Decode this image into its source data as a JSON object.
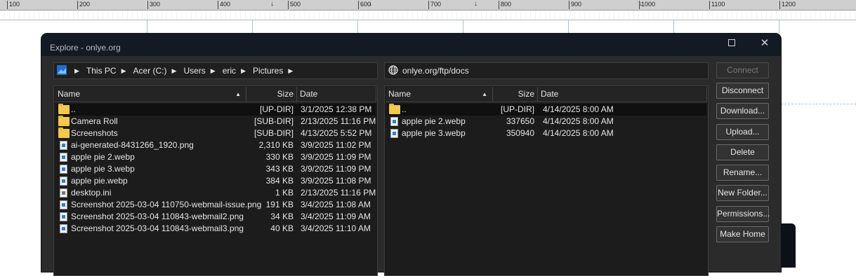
{
  "ruler": {
    "labels": [
      "100",
      "200",
      "300",
      "400",
      "500",
      "600",
      "700",
      "800",
      "900",
      "1000",
      "1100",
      "1200"
    ],
    "tab_stop": "↓"
  },
  "window": {
    "title": "Explore  - onlye.org",
    "maximize_label": "",
    "close_label": "✕"
  },
  "local": {
    "breadcrumbs": [
      "This PC",
      "Acer (C:)",
      "Users",
      "eric",
      "Pictures"
    ],
    "columns": {
      "name": "Name",
      "size": "Size",
      "date": "Date"
    },
    "sort_indicator": "▲",
    "files": [
      {
        "name": "..",
        "size": "[UP-DIR]",
        "date": "3/1/2025 12:38 PM",
        "icon": "folder"
      },
      {
        "name": "Camera Roll",
        "size": "[SUB-DIR]",
        "date": "2/13/2025 11:16 PM",
        "icon": "folder"
      },
      {
        "name": "Screenshots",
        "size": "[SUB-DIR]",
        "date": "4/13/2025 5:52 PM",
        "icon": "folder"
      },
      {
        "name": "ai-generated-8431266_1920.png",
        "size": "2,310 KB",
        "date": "3/9/2025 11:02 PM",
        "icon": "image"
      },
      {
        "name": "apple pie 2.webp",
        "size": "330 KB",
        "date": "3/9/2025 11:09 PM",
        "icon": "image"
      },
      {
        "name": "apple pie 3.webp",
        "size": "343 KB",
        "date": "3/9/2025 11:09 PM",
        "icon": "image"
      },
      {
        "name": "apple pie.webp",
        "size": "384 KB",
        "date": "3/9/2025 11:08 PM",
        "icon": "image"
      },
      {
        "name": "desktop.ini",
        "size": "1 KB",
        "date": "2/13/2025 11:16 PM",
        "icon": "settings-file"
      },
      {
        "name": "Screenshot 2025-03-04 110750-webmail-issue.png",
        "size": "191 KB",
        "date": "3/4/2025 11:08 AM",
        "icon": "image"
      },
      {
        "name": "Screenshot 2025-03-04 110843-webmail2.png",
        "size": "34 KB",
        "date": "3/4/2025 11:09 AM",
        "icon": "image"
      },
      {
        "name": "Screenshot 2025-03-04 110843-webmail3.png",
        "size": "40 KB",
        "date": "3/4/2025 11:10 AM",
        "icon": "image"
      }
    ]
  },
  "remote": {
    "path": "onlye.org/ftp/docs",
    "columns": {
      "name": "Name",
      "size": "Size",
      "date": "Date"
    },
    "sort_indicator": "▲",
    "files": [
      {
        "name": "..",
        "size": "[UP-DIR]",
        "date": "4/14/2025 8:00 AM",
        "icon": "folder"
      },
      {
        "name": "apple pie 2.webp",
        "size": "337650",
        "date": "4/14/2025 8:00 AM",
        "icon": "image"
      },
      {
        "name": "apple pie 3.webp",
        "size": "350940",
        "date": "4/14/2025 8:00 AM",
        "icon": "image"
      }
    ]
  },
  "buttons": {
    "connect": "Connect",
    "disconnect": "Disconnect",
    "download": "Download...",
    "upload": "Upload...",
    "delete": "Delete",
    "rename": "Rename...",
    "new_folder": "New Folder...",
    "permissions": "Permissions...",
    "make_home": "Make Home"
  }
}
